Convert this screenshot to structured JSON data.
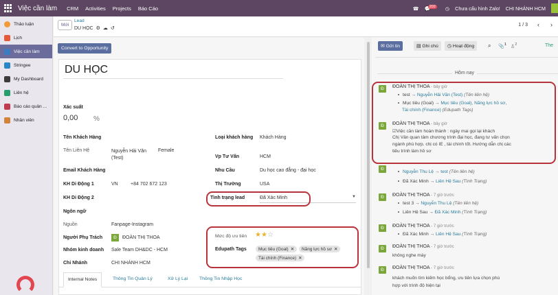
{
  "topbar": {
    "brand": "Việc cần làm",
    "menus": [
      "CRM",
      "Activities",
      "Projects",
      "Báo Cáo"
    ],
    "message_count": "202",
    "zalo_status": "Chưa cấu hình Zalo!",
    "branch": "CHI NHÁNH HCM"
  },
  "sidebar": {
    "items": [
      {
        "label": "Thảo luận",
        "color": "#f29c38"
      },
      {
        "label": "Lịch",
        "color": "#e55a3a"
      },
      {
        "label": "Việc cần làm",
        "color": "#3b7bbf"
      },
      {
        "label": "Stringee",
        "color": "#2a86c7"
      },
      {
        "label": "My Dashboard",
        "color": "#3c3c3c"
      },
      {
        "label": "Liên hệ",
        "color": "#2a9d6f"
      },
      {
        "label": "Báo cáo quản ...",
        "color": "#c03b50"
      },
      {
        "label": "Nhân viên",
        "color": "#d1843a"
      }
    ]
  },
  "control": {
    "new_button": "Mới",
    "breadcrumb_parent": "Lead",
    "breadcrumb_current": "DU HỌC",
    "pager": "1 / 3"
  },
  "form": {
    "convert_button": "Convert to Opportunity",
    "title": "DU HỌC",
    "probability_label": "Xác suất",
    "probability_value": "0,00",
    "probability_unit": "%",
    "left": {
      "customer_name_label": "Tên Khách Hàng",
      "contact_name_label": "Tên Liên Hệ",
      "contact_name_value": "Nguyễn Hải Văn (Test)",
      "gender_value": "Female",
      "email_label": "Email Khách Hàng",
      "phone1_label": "KH Di Động 1",
      "phone1_country": "VN",
      "phone1_value": "+84 702 672 123",
      "phone2_label": "KH Di Động 2",
      "language_label": "Ngôn ngữ",
      "source_label": "Nguồn",
      "source_value": "Fanpage-Instagram",
      "owner_label": "Người Phụ Trách",
      "owner_value": "ĐOÀN THỊ THOA",
      "team_label": "Nhóm kinh doanh",
      "team_value": "Sale Team DH&DC - HCM",
      "branch_label": "Chi Nhánh",
      "branch_value": "CHI NHÁNH HCM"
    },
    "right": {
      "customer_type_label": "Loại khách hàng",
      "customer_type_value": "Khách Hàng",
      "advisor_label": "Vp Tư Vấn",
      "advisor_value": "HCM",
      "need_label": "Nhu Cầu",
      "need_value": "Du học cao đẳng - đại học",
      "market_label": "Thị Trường",
      "market_value": "USA",
      "lead_status_label": "Tình trạng lead",
      "lead_status_value": "Đã Xác Minh",
      "priority_label": "Mức độ ưu tiên",
      "priority_stars": 2,
      "priority_max": 3,
      "edupath_label": "Edupath Tags",
      "edupath_tags": [
        "Mục tiêu (Goal)",
        "Năng lực hồ sơ",
        "Tài chính (Finance)"
      ]
    },
    "tabs": [
      "Internal Notes",
      "Thông Tin Quản Lý",
      "Xử Lý Lại",
      "Thông Tin Nhập Học"
    ]
  },
  "chatter": {
    "send_button": "Gửi tin",
    "note_button": "Ghi chú",
    "activity_button": "Hoạt động",
    "attachment_count": "1",
    "follower_count": "2",
    "follow_label": "The",
    "date_divider": "Hôm nay",
    "messages": [
      {
        "author": "ĐOÀN THỊ THOA",
        "time": "- bây giờ",
        "lines": [
          {
            "pre": "test",
            "link": "Nguyễn Hải Văn (Test)",
            "note": "(Tên liên hệ)"
          },
          {
            "pre": "Mục tiêu (Goal)",
            "link": "Mục tiêu (Goal), Năng lực hồ sơ,",
            "note": ""
          },
          {
            "pre": "",
            "link": "Tài chính (Finance)",
            "note": "(Edupath Tags)"
          }
        ]
      },
      {
        "author": "ĐOÀN THỊ THOA",
        "time": "- bây giờ",
        "body": [
          "☑Việc cần làm hoàn thành : ngày mai gọi lại khách",
          "Chị Vân quan tâm chương trình đại học, đang tư vấn chọn",
          "ngành phù hợp. chị có IE , tài chính tốt. Hướng dẫn chị các",
          "tiêu trình làm hồ sơ"
        ]
      },
      {
        "author": "",
        "time": "",
        "lines": [
          {
            "pre": "Nguyễn Thu Lệ",
            "link": "test",
            "note": "(Tên liên hệ)"
          },
          {
            "pre": "Đã Xác Minh",
            "link": "Liên Hệ Sau",
            "note": "(Tình Trạng)"
          }
        ]
      },
      {
        "author": "ĐOÀN THỊ THOA",
        "time": "- 7 giờ trước",
        "lines": [
          {
            "pre": "test 3",
            "link": "Nguyễn Thu Lệ",
            "note": "(Tên liên hệ)"
          },
          {
            "pre": "Liên Hệ Sau",
            "link": "Đã Xác Minh",
            "note": "(Tình Trạng)"
          }
        ]
      },
      {
        "author": "ĐOÀN THỊ THOA",
        "time": "- 7 giờ trước",
        "lines": [
          {
            "pre": "Đã Xác Minh",
            "link": "Liên Hệ Sau",
            "note": "(Tình Trạng)"
          }
        ]
      },
      {
        "author": "ĐOÀN THỊ THOA",
        "time": "- 7 giờ trước",
        "body": [
          "không nghe máy"
        ]
      },
      {
        "author": "ĐOÀN THỊ THOA",
        "time": "- 7 giờ trước",
        "body": [
          "khách muốn tìm kiếm học bổng, ưu tiên lựa chọn phù",
          "hợp với trình độ hiện tại"
        ]
      }
    ]
  }
}
